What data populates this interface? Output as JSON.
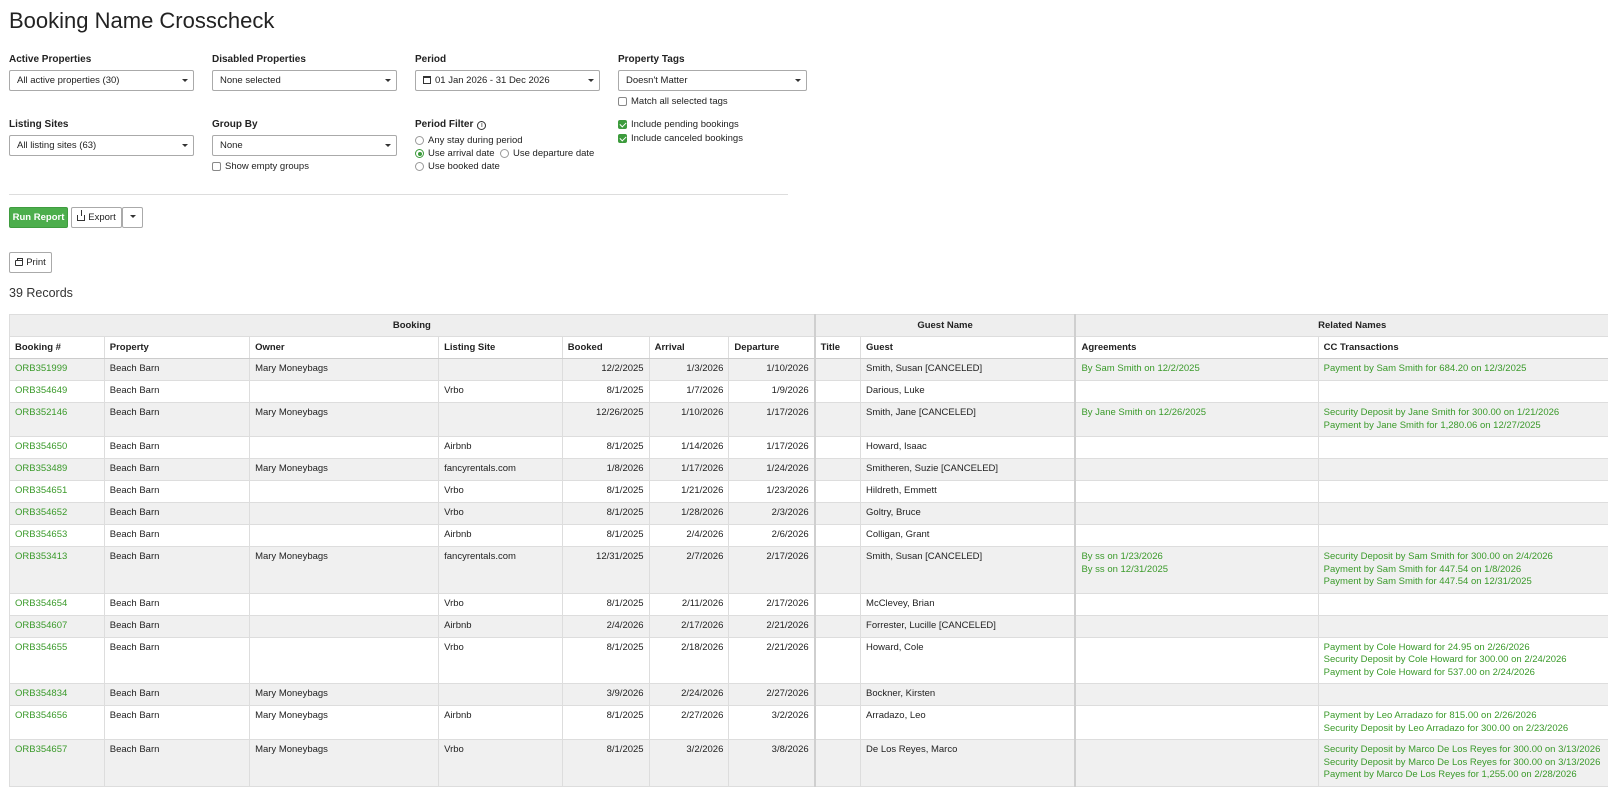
{
  "page": {
    "title": "Booking Name Crosscheck"
  },
  "filters": {
    "active_properties": {
      "label": "Active Properties",
      "value": "All active properties (30)"
    },
    "disabled_properties": {
      "label": "Disabled Properties",
      "value": "None selected"
    },
    "period": {
      "label": "Period",
      "value": "01 Jan 2026 - 31 Dec 2026"
    },
    "property_tags": {
      "label": "Property Tags",
      "value": "Doesn't Matter",
      "match_all_label": "Match all selected tags",
      "match_all_checked": false
    },
    "listing_sites": {
      "label": "Listing Sites",
      "value": "All listing sites (63)"
    },
    "group_by": {
      "label": "Group By",
      "value": "None",
      "show_empty_label": "Show empty groups",
      "show_empty_checked": false
    },
    "period_filter": {
      "label": "Period Filter",
      "options": [
        "Any stay during period",
        "Use arrival date",
        "Use departure date",
        "Use booked date"
      ],
      "selected": "Use arrival date"
    },
    "include_pending": {
      "label": "Include pending bookings",
      "checked": true
    },
    "include_canceled": {
      "label": "Include canceled bookings",
      "checked": true
    }
  },
  "actions": {
    "run_report": "Run Report",
    "export": "Export",
    "print": "Print"
  },
  "records_label": "39 Records",
  "table": {
    "groups": [
      "Booking",
      "Guest Name",
      "Related Names"
    ],
    "columns": [
      "Booking #",
      "Property",
      "Owner",
      "Listing Site",
      "Booked",
      "Arrival",
      "Departure",
      "Title",
      "Guest",
      "Agreements",
      "CC Transactions"
    ],
    "rows": [
      {
        "booking": "ORB351999",
        "property": "Beach Barn",
        "owner": "Mary Moneybags",
        "site": "",
        "booked": "12/2/2025",
        "arrival": "1/3/2026",
        "departure": "1/10/2026",
        "title": "",
        "guest": "Smith, Susan [CANCELED]",
        "agreements": [
          "By Sam Smith on 12/2/2025"
        ],
        "cc": [
          "Payment by Sam Smith for 684.20 on 12/3/2025"
        ]
      },
      {
        "booking": "ORB354649",
        "property": "Beach Barn",
        "owner": "",
        "site": "Vrbo",
        "booked": "8/1/2025",
        "arrival": "1/7/2026",
        "departure": "1/9/2026",
        "title": "",
        "guest": "Darious, Luke",
        "agreements": [],
        "cc": []
      },
      {
        "booking": "ORB352146",
        "property": "Beach Barn",
        "owner": "Mary Moneybags",
        "site": "",
        "booked": "12/26/2025",
        "arrival": "1/10/2026",
        "departure": "1/17/2026",
        "title": "",
        "guest": "Smith, Jane [CANCELED]",
        "agreements": [
          "By Jane Smith on 12/26/2025"
        ],
        "cc": [
          "Security Deposit by Jane Smith for 300.00 on 1/21/2026",
          "Payment by Jane Smith for 1,280.06 on 12/27/2025"
        ]
      },
      {
        "booking": "ORB354650",
        "property": "Beach Barn",
        "owner": "",
        "site": "Airbnb",
        "booked": "8/1/2025",
        "arrival": "1/14/2026",
        "departure": "1/17/2026",
        "title": "",
        "guest": "Howard, Isaac",
        "agreements": [],
        "cc": []
      },
      {
        "booking": "ORB353489",
        "property": "Beach Barn",
        "owner": "Mary Moneybags",
        "site": "fancyrentals.com",
        "booked": "1/8/2026",
        "arrival": "1/17/2026",
        "departure": "1/24/2026",
        "title": "",
        "guest": "Smitheren, Suzie [CANCELED]",
        "agreements": [],
        "cc": []
      },
      {
        "booking": "ORB354651",
        "property": "Beach Barn",
        "owner": "",
        "site": "Vrbo",
        "booked": "8/1/2025",
        "arrival": "1/21/2026",
        "departure": "1/23/2026",
        "title": "",
        "guest": "Hildreth, Emmett",
        "agreements": [],
        "cc": []
      },
      {
        "booking": "ORB354652",
        "property": "Beach Barn",
        "owner": "",
        "site": "Vrbo",
        "booked": "8/1/2025",
        "arrival": "1/28/2026",
        "departure": "2/3/2026",
        "title": "",
        "guest": "Goltry, Bruce",
        "agreements": [],
        "cc": []
      },
      {
        "booking": "ORB354653",
        "property": "Beach Barn",
        "owner": "",
        "site": "Airbnb",
        "booked": "8/1/2025",
        "arrival": "2/4/2026",
        "departure": "2/6/2026",
        "title": "",
        "guest": "Colligan, Grant",
        "agreements": [],
        "cc": []
      },
      {
        "booking": "ORB353413",
        "property": "Beach Barn",
        "owner": "Mary Moneybags",
        "site": "fancyrentals.com",
        "booked": "12/31/2025",
        "arrival": "2/7/2026",
        "departure": "2/17/2026",
        "title": "",
        "guest": "Smith, Susan [CANCELED]",
        "agreements": [
          "By ss on 1/23/2026",
          "By ss on 12/31/2025"
        ],
        "cc": [
          "Security Deposit by Sam Smith for 300.00 on 2/4/2026",
          "Payment by Sam Smith for 447.54 on 1/8/2026",
          "Payment by Sam Smith for 447.54 on 12/31/2025"
        ]
      },
      {
        "booking": "ORB354654",
        "property": "Beach Barn",
        "owner": "",
        "site": "Vrbo",
        "booked": "8/1/2025",
        "arrival": "2/11/2026",
        "departure": "2/17/2026",
        "title": "",
        "guest": "McClevey, Brian",
        "agreements": [],
        "cc": []
      },
      {
        "booking": "ORB354607",
        "property": "Beach Barn",
        "owner": "",
        "site": "Airbnb",
        "booked": "2/4/2026",
        "arrival": "2/17/2026",
        "departure": "2/21/2026",
        "title": "",
        "guest": "Forrester, Lucille [CANCELED]",
        "agreements": [],
        "cc": []
      },
      {
        "booking": "ORB354655",
        "property": "Beach Barn",
        "owner": "",
        "site": "Vrbo",
        "booked": "8/1/2025",
        "arrival": "2/18/2026",
        "departure": "2/21/2026",
        "title": "",
        "guest": "Howard, Cole",
        "agreements": [],
        "cc": [
          "Payment by Cole Howard for 24.95 on 2/26/2026",
          "Security Deposit by Cole Howard for 300.00 on 2/24/2026",
          "Payment by Cole Howard for 537.00 on 2/24/2026"
        ]
      },
      {
        "booking": "ORB354834",
        "property": "Beach Barn",
        "owner": "Mary Moneybags",
        "site": "",
        "booked": "3/9/2026",
        "arrival": "2/24/2026",
        "departure": "2/27/2026",
        "title": "",
        "guest": "Bockner, Kirsten",
        "agreements": [],
        "cc": []
      },
      {
        "booking": "ORB354656",
        "property": "Beach Barn",
        "owner": "Mary Moneybags",
        "site": "Airbnb",
        "booked": "8/1/2025",
        "arrival": "2/27/2026",
        "departure": "3/2/2026",
        "title": "",
        "guest": "Arradazo, Leo",
        "agreements": [],
        "cc": [
          "Payment by Leo Arradazo for 815.00 on 2/26/2026",
          "Security Deposit by Leo Arradazo for 300.00 on 2/23/2026"
        ]
      },
      {
        "booking": "ORB354657",
        "property": "Beach Barn",
        "owner": "Mary Moneybags",
        "site": "Vrbo",
        "booked": "8/1/2025",
        "arrival": "3/2/2026",
        "departure": "3/8/2026",
        "title": "",
        "guest": "De Los Reyes, Marco",
        "agreements": [],
        "cc": [
          "Security Deposit by Marco De Los Reyes for 300.00 on 3/13/2026",
          "Security Deposit by Marco De Los Reyes for 300.00 on 3/13/2026",
          "Payment by Marco De Los Reyes for 1,255.00 on 2/28/2026"
        ]
      }
    ]
  },
  "colors": {
    "accent_green": "#4cae4c",
    "link_green": "#3a9a2a",
    "header_bg": "#eeeeee",
    "stripe_bg": "#f0f0f0"
  }
}
